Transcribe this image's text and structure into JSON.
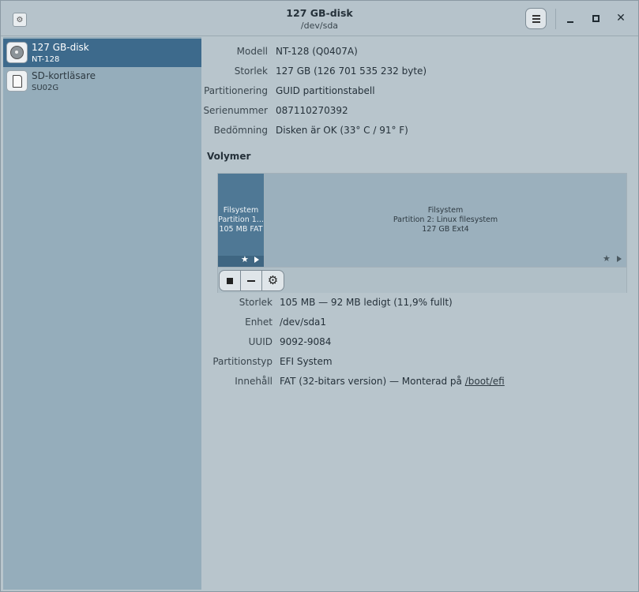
{
  "window": {
    "title": "127 GB-disk",
    "subtitle": "/dev/sda"
  },
  "icons": {
    "app": "disks-app-icon",
    "menu": "hamburger-menu-icon",
    "minimize": "minimize-icon",
    "maximize": "maximize-icon",
    "close": "close-icon"
  },
  "sidebar": {
    "items": [
      {
        "name": "127 GB-disk",
        "model": "NT-128",
        "icon": "hard-disk-icon",
        "selected": true
      },
      {
        "name": "SD-kortläsare",
        "model": "SU02G",
        "icon": "sd-card-icon",
        "selected": false
      }
    ]
  },
  "disk": {
    "rows": [
      {
        "label": "Modell",
        "value": "NT-128 (Q0407A)"
      },
      {
        "label": "Storlek",
        "value": "127 GB (126 701 535 232 byte)"
      },
      {
        "label": "Partitionering",
        "value": "GUID partitionstabell"
      },
      {
        "label": "Serienummer",
        "value": "087110270392"
      },
      {
        "label": "Bedömning",
        "value": "Disken är OK (33° C / 91° F)"
      }
    ]
  },
  "volumes": {
    "title": "Volymer",
    "partitions": [
      {
        "line1": "Filsystem",
        "line2": "Partition 1...",
        "line3": "105 MB FAT",
        "selected": true
      },
      {
        "line1": "Filsystem",
        "line2": "Partition 2: Linux filesystem",
        "line3": "127 GB Ext4",
        "selected": false
      }
    ],
    "toolbar": {
      "stop": "stop-icon",
      "delete": "minus-icon",
      "options": "gears-icon"
    }
  },
  "partition_details": {
    "rows": [
      {
        "label": "Storlek",
        "value": "105 MB — 92 MB ledigt (11,9% fullt)"
      },
      {
        "label": "Enhet",
        "value": "/dev/sda1"
      },
      {
        "label": "UUID",
        "value": "9092-9084"
      },
      {
        "label": "Partitionstyp",
        "value": "EFI System"
      }
    ],
    "content_label": "Innehåll",
    "content_value": "FAT (32-bitars version) — Monterad på",
    "mount_point": "/boot/efi"
  },
  "colors": {
    "selected": "#3d6a8c",
    "sidebar": "#95adbb",
    "main": "#b8c5cc"
  }
}
